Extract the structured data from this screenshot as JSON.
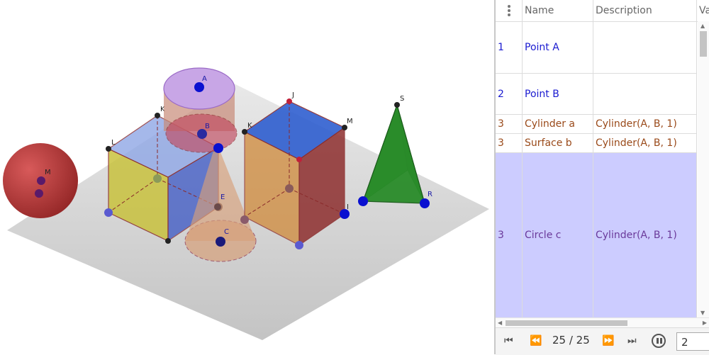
{
  "view3d": {
    "labels": {
      "A": "A",
      "B": "B",
      "C": "C",
      "E": "E",
      "M": "M",
      "S": "S",
      "R": "R",
      "K": "K",
      "L": "L",
      "J1": "J",
      "M1": "M",
      "K1": "K",
      "I1": "I"
    },
    "colors": {
      "ground": "#cfcfcf",
      "sphere": "#b13a3a",
      "cube_left_front": "#c9c23e",
      "cube_left_side": "#3a56c4",
      "cube_left_top": "#8fa7e6",
      "cube_right_top": "#2f5fd0",
      "cube_right_front": "#d08a3a",
      "cube_right_side": "#9a3a3a",
      "cylinder_top": "#c8a6e6",
      "cylinder_body": "#d7a07a",
      "pyramid": "#2a8c2a",
      "point_blue": "#0a10d0",
      "point_dark": "#222222"
    }
  },
  "table": {
    "menu_icon": "vertical-dots-icon",
    "headers": [
      "Name",
      "Description",
      "Va"
    ],
    "rows": [
      {
        "num": "1",
        "name": "Point A",
        "desc": "",
        "color": "#1a1ad0",
        "bg": "#ffffff"
      },
      {
        "num": "2",
        "name": "Point B",
        "desc": "",
        "color": "#1a1ad0",
        "bg": "#ffffff"
      },
      {
        "num": "3",
        "name": "Cylinder a",
        "desc": "Cylinder(A, B, 1)",
        "color": "#9a4a1a",
        "bg": "#ffffff"
      },
      {
        "num": "3",
        "name": "Surface b",
        "desc": "Cylinder(A, B, 1)",
        "color": "#9a4a1a",
        "bg": "#ffffff"
      },
      {
        "num": "3",
        "name": "Circle c",
        "desc": "Cylinder(A, B, 1)",
        "color": "#6a3a9a",
        "bg": "#ccccff"
      }
    ]
  },
  "navigation": {
    "counter": "25 / 25",
    "speed": "2",
    "buttons": [
      "first-step-icon",
      "previous-step-icon",
      "next-step-icon",
      "last-step-icon",
      "pause-icon"
    ]
  }
}
